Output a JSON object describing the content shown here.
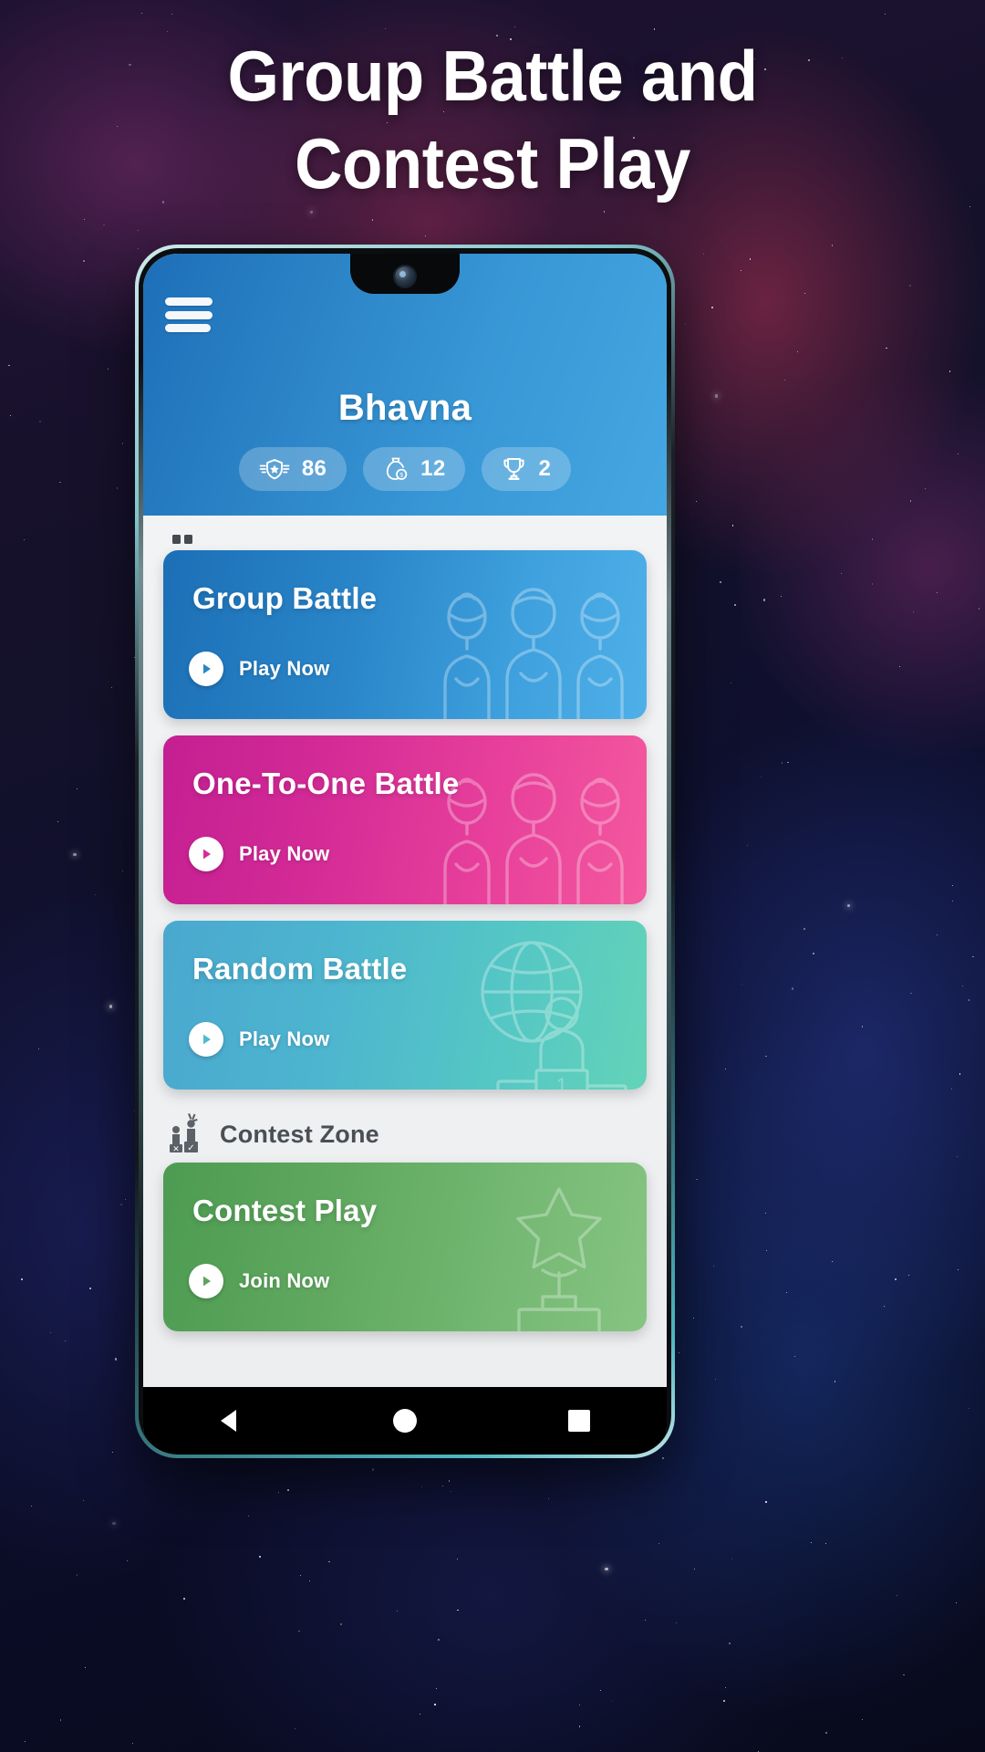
{
  "promo": {
    "headline_line1": "Group Battle and",
    "headline_line2": "Contest Play"
  },
  "app": {
    "header": {
      "menu_icon": "hamburger-menu-icon",
      "username": "Bhavna",
      "stats": [
        {
          "icon": "badge-shield-star-icon",
          "value": "86"
        },
        {
          "icon": "coin-bag-icon",
          "value": "12"
        },
        {
          "icon": "trophy-icon",
          "value": "2"
        }
      ]
    },
    "sections": [
      {
        "label": "",
        "icon": "battle-zone-icon",
        "clipped": true,
        "cards": [
          {
            "title": "Group Battle",
            "cta": "Play Now",
            "color": "#2a86c9",
            "theme": "blue",
            "art": "group-people-icon"
          },
          {
            "title": "One-To-One Battle",
            "cta": "Play Now",
            "color": "#d32a96",
            "theme": "pink",
            "art": "group-people-icon"
          },
          {
            "title": "Random Battle",
            "cta": "Play Now",
            "color": "#55c7c4",
            "theme": "teal",
            "art": "globe-podium-icon"
          }
        ]
      },
      {
        "label": "Contest Zone",
        "icon": "contest-quiz-icon",
        "clipped": false,
        "cards": [
          {
            "title": "Contest Play",
            "cta": "Join Now",
            "color": "#60a85f",
            "theme": "green",
            "art": "trophy-star-icon"
          }
        ]
      }
    ],
    "navbar": {
      "back": "back-triangle-icon",
      "home": "home-circle-icon",
      "recents": "recents-square-icon"
    }
  }
}
